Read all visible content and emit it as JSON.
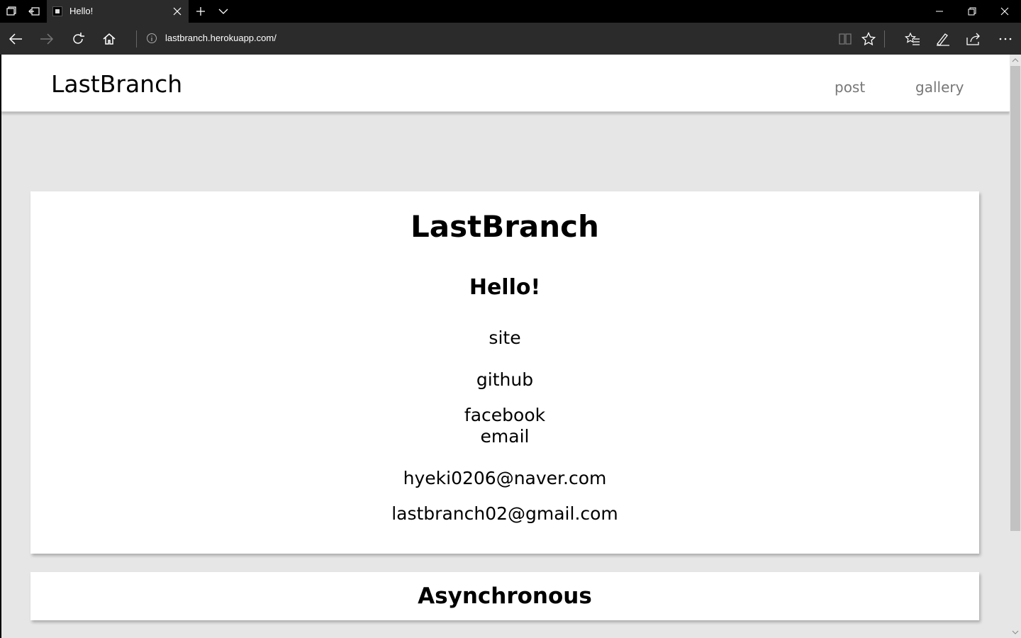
{
  "browser": {
    "tab_title": "Hello!",
    "url": "lastbranch.herokuapp.com/"
  },
  "site": {
    "brand": "LastBranch",
    "nav": [
      {
        "label": "post"
      },
      {
        "label": "gallery"
      }
    ]
  },
  "main_card": {
    "title": "LastBranch",
    "greeting": "Hello!",
    "links": {
      "site": "site",
      "github": "github",
      "facebook": "facebook",
      "email": "email"
    },
    "emails": [
      "hyeki0206@naver.com",
      "lastbranch02@gmail.com"
    ]
  },
  "next_card": {
    "title": "Asynchronous"
  }
}
